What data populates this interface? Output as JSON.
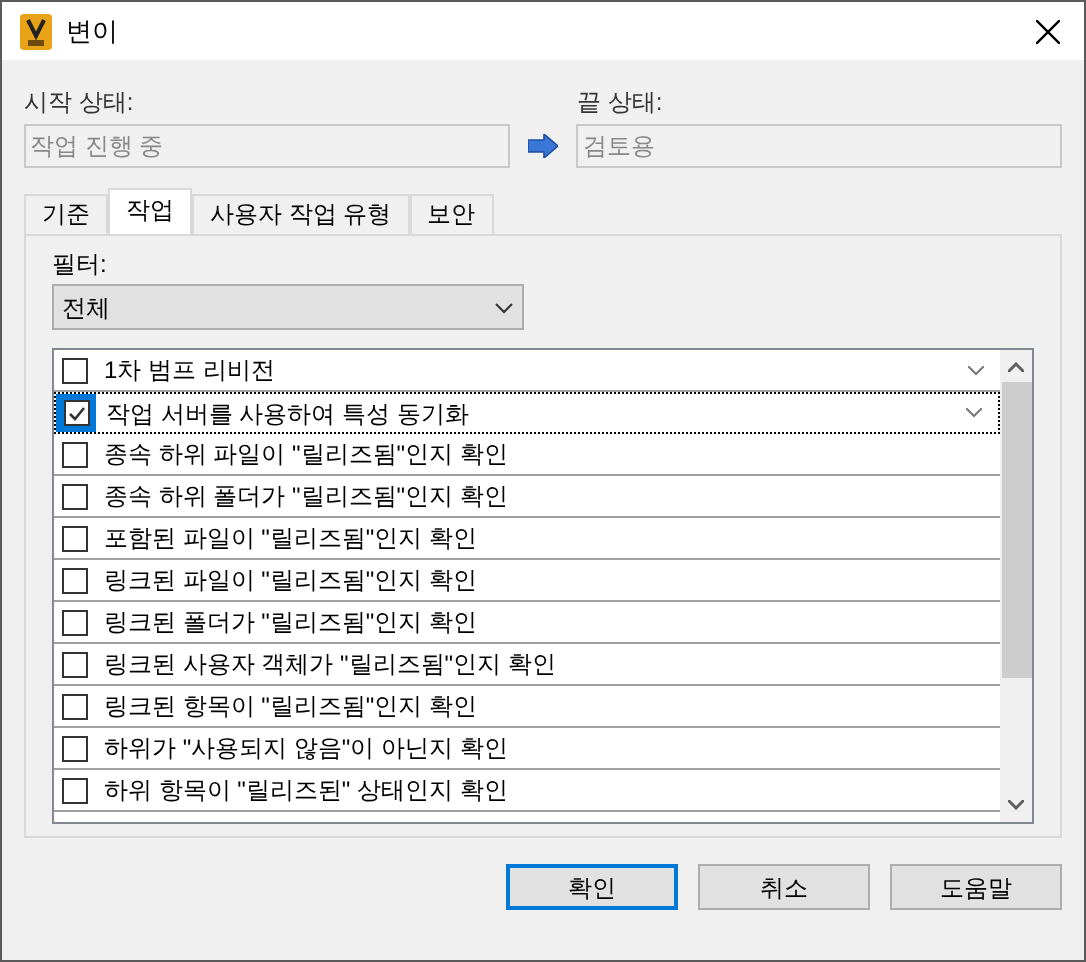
{
  "window": {
    "title": "변이"
  },
  "start_state": {
    "label": "시작 상태:",
    "value": "작업 진행 중"
  },
  "end_state": {
    "label": "끝 상태:",
    "value": "검토용"
  },
  "tabs": [
    {
      "label": "기준",
      "selected": false
    },
    {
      "label": "작업",
      "selected": true
    },
    {
      "label": "사용자 작업 유형",
      "selected": false
    },
    {
      "label": "보안",
      "selected": false
    }
  ],
  "filter": {
    "label": "필터:",
    "value": "전체"
  },
  "actions": [
    {
      "label": "1차 범프 리비전",
      "checked": false,
      "selected": false,
      "expandable": true
    },
    {
      "label": "작업 서버를 사용하여 특성 동기화",
      "checked": true,
      "selected": true,
      "expandable": true
    },
    {
      "label": "종속 하위 파일이 \"릴리즈됨\"인지 확인",
      "checked": false,
      "selected": false,
      "expandable": false
    },
    {
      "label": "종속 하위 폴더가 \"릴리즈됨\"인지 확인",
      "checked": false,
      "selected": false,
      "expandable": false
    },
    {
      "label": "포함된 파일이 \"릴리즈됨\"인지 확인",
      "checked": false,
      "selected": false,
      "expandable": false
    },
    {
      "label": "링크된 파일이 \"릴리즈됨\"인지 확인",
      "checked": false,
      "selected": false,
      "expandable": false
    },
    {
      "label": "링크된 폴더가 \"릴리즈됨\"인지 확인",
      "checked": false,
      "selected": false,
      "expandable": false
    },
    {
      "label": "링크된 사용자 객체가 \"릴리즈됨\"인지 확인",
      "checked": false,
      "selected": false,
      "expandable": false
    },
    {
      "label": "링크된 항목이 \"릴리즈됨\"인지 확인",
      "checked": false,
      "selected": false,
      "expandable": false
    },
    {
      "label": "하위가 \"사용되지 않음\"이 아닌지 확인",
      "checked": false,
      "selected": false,
      "expandable": false
    },
    {
      "label": "하위 항목이 \"릴리즈된\" 상태인지 확인",
      "checked": false,
      "selected": false,
      "expandable": false
    }
  ],
  "buttons": [
    {
      "label": "확인",
      "default": true
    },
    {
      "label": "취소",
      "default": false
    },
    {
      "label": "도움말",
      "default": false
    }
  ]
}
